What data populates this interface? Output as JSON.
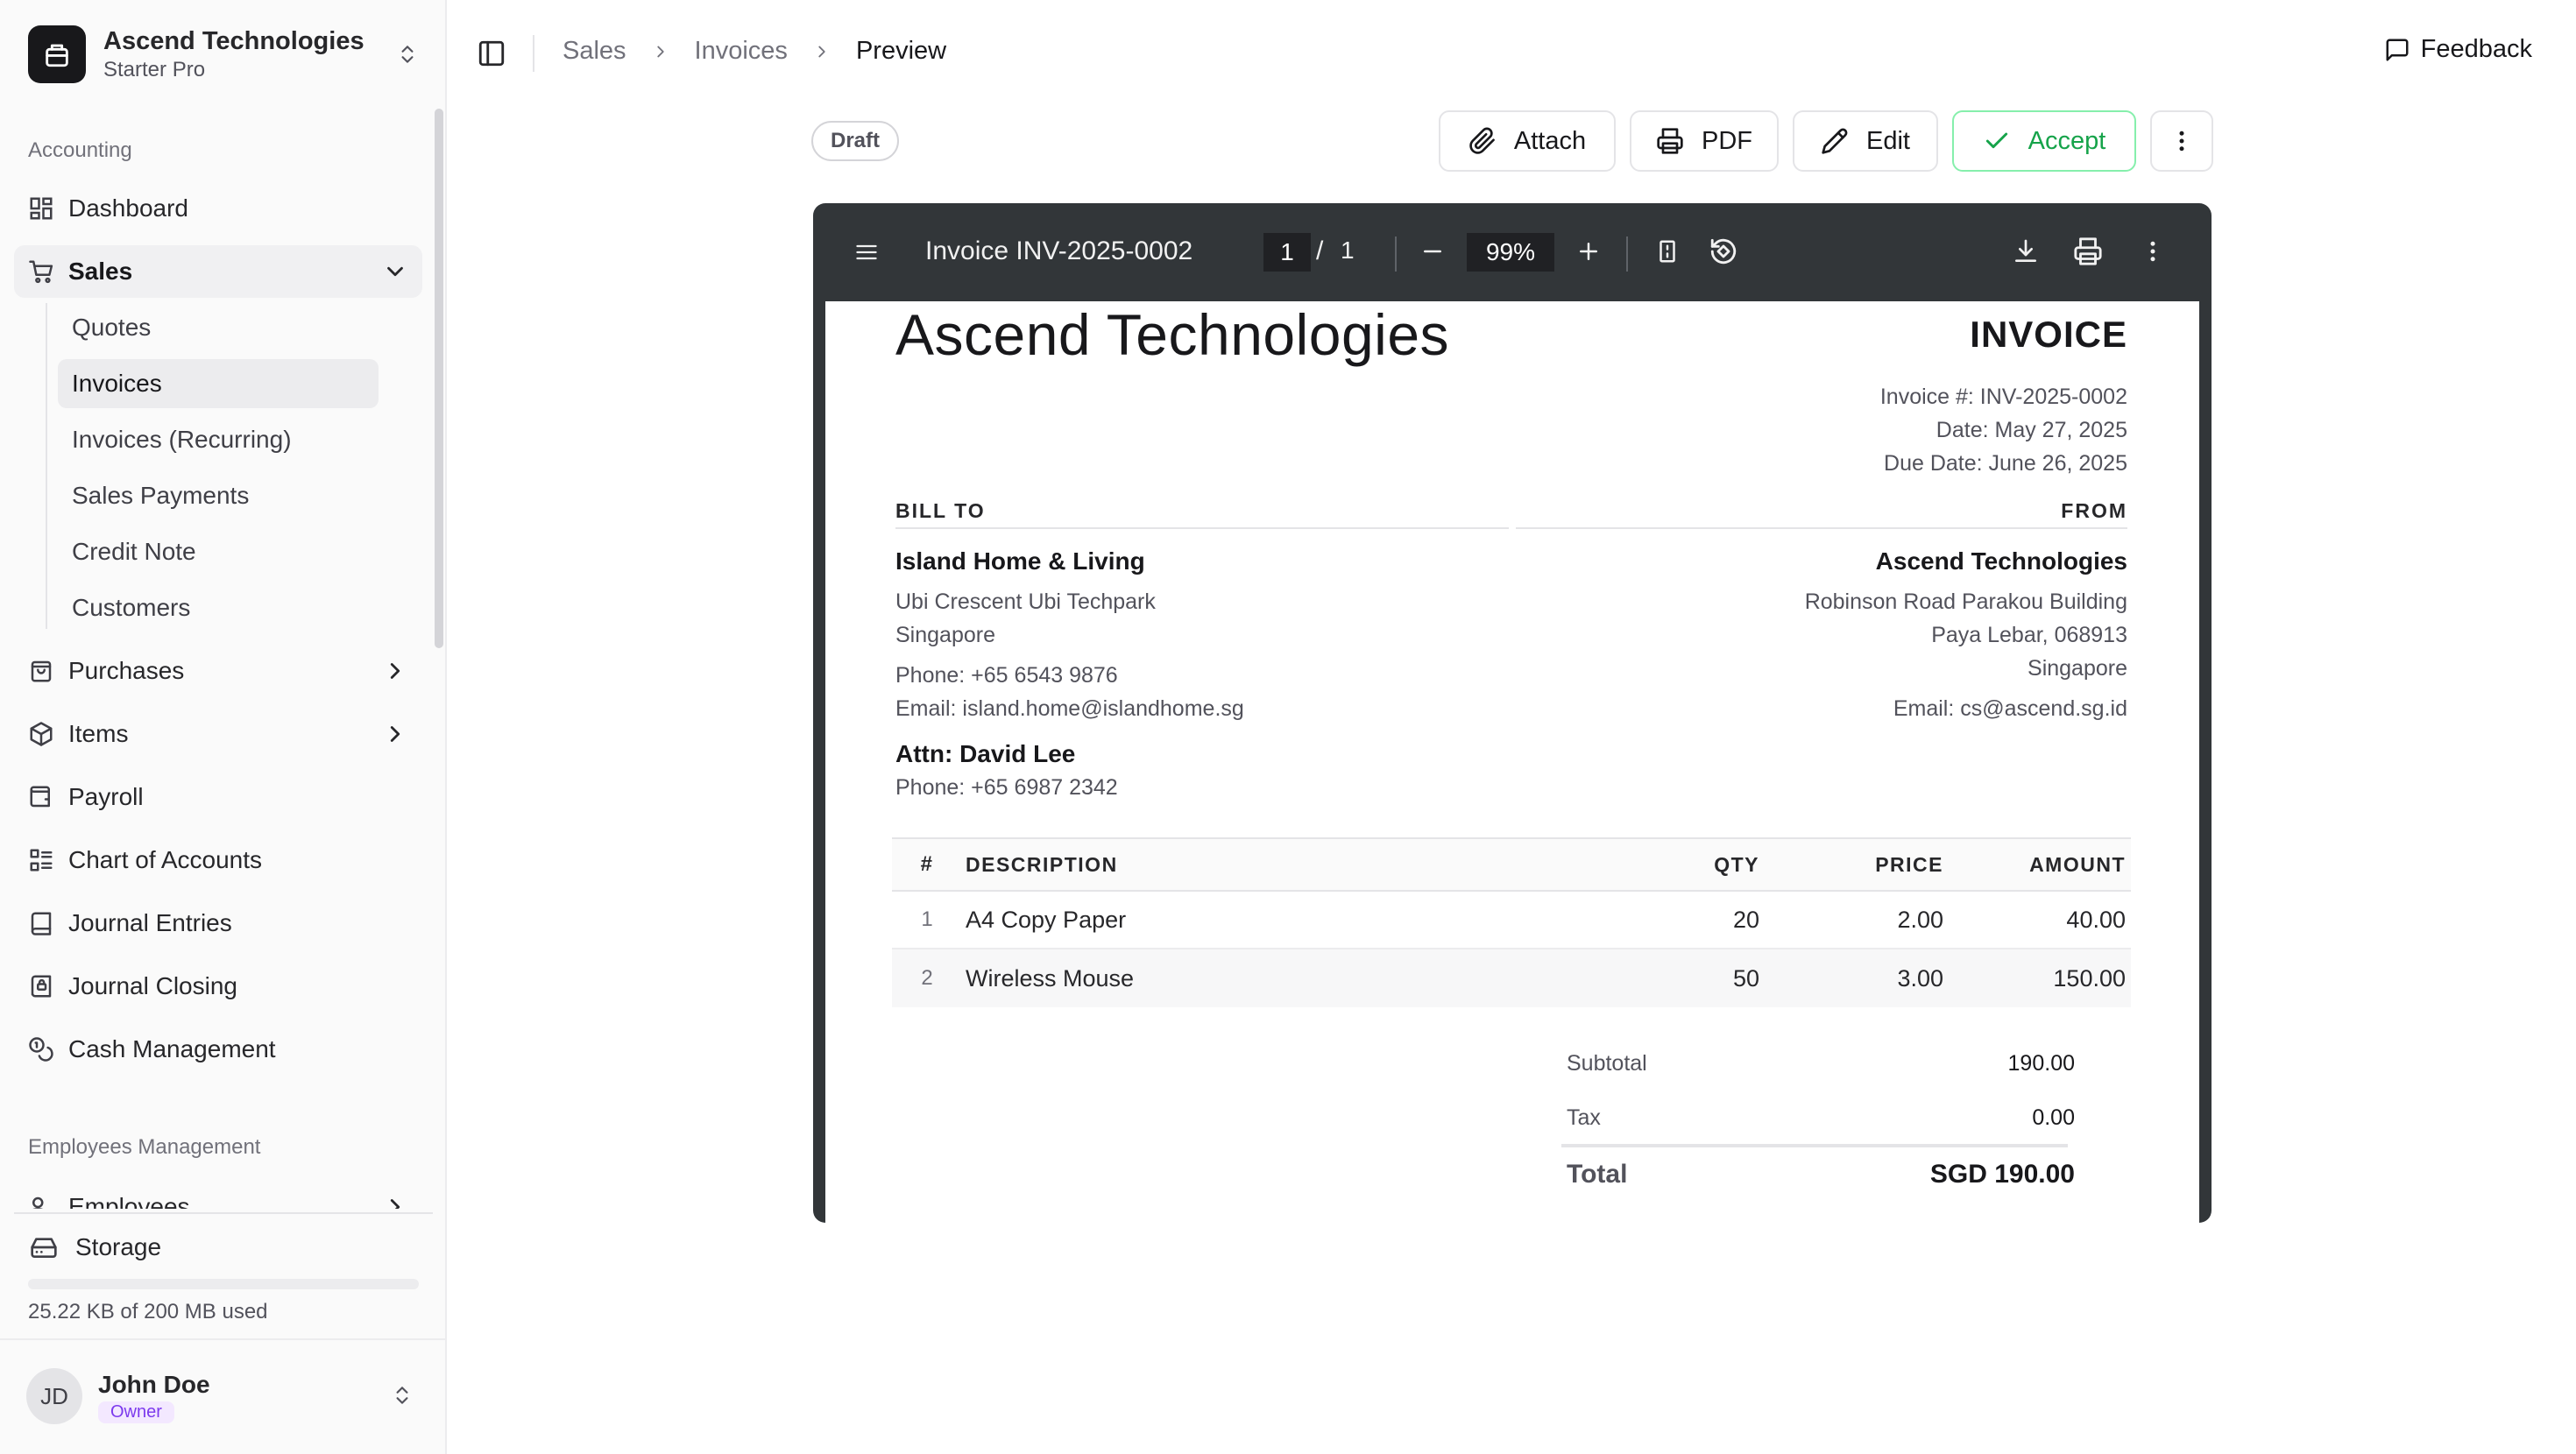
{
  "org": {
    "name": "Ascend Technologies",
    "plan": "Starter Pro"
  },
  "sidebar": {
    "section_accounting": "Accounting",
    "dashboard": "Dashboard",
    "sales": "Sales",
    "sales_items": [
      "Quotes",
      "Invoices",
      "Invoices (Recurring)",
      "Sales Payments",
      "Credit Note",
      "Customers"
    ],
    "purchases": "Purchases",
    "items": "Items",
    "payroll": "Payroll",
    "chart_of_accounts": "Chart of Accounts",
    "journal_entries": "Journal Entries",
    "journal_closing": "Journal Closing",
    "cash_management": "Cash Management",
    "section_employees": "Employees Management",
    "employees": "Employees",
    "storage": "Storage",
    "storage_used": "25.22 KB of 200 MB used",
    "storage_fraction": 0.0001
  },
  "user": {
    "initials": "JD",
    "name": "John Doe",
    "role": "Owner"
  },
  "breadcrumb": [
    "Sales",
    "Invoices",
    "Preview"
  ],
  "feedback": "Feedback",
  "status_badge": "Draft",
  "actions": {
    "attach": "Attach",
    "pdf": "PDF",
    "edit": "Edit",
    "accept": "Accept"
  },
  "viewer": {
    "title": "Invoice INV-2025-0002",
    "page": "1",
    "page_sep": "/",
    "pages": "1",
    "zoom": "99%"
  },
  "invoice": {
    "company": "Ascend Technologies",
    "heading": "INVOICE",
    "number_line": "Invoice #: INV-2025-0002",
    "date_line": "Date: May 27, 2025",
    "due_line": "Due Date: June 26, 2025",
    "bill_to_label": "BILL TO",
    "from_label": "FROM",
    "bill_to": {
      "name": "Island Home & Living",
      "address1": "Ubi Crescent Ubi Techpark",
      "address2": "Singapore",
      "phone": "Phone: +65 6543 9876",
      "email": "Email: island.home@islandhome.sg",
      "attn": "Attn: David Lee",
      "attn_phone": "Phone: +65 6987 2342"
    },
    "from": {
      "name": "Ascend Technologies",
      "address1": "Robinson Road Parakou Building",
      "address2": "Paya Lebar, 068913",
      "address3": "Singapore",
      "email": "Email: cs@ascend.sg.id"
    },
    "columns": {
      "num": "#",
      "desc": "DESCRIPTION",
      "qty": "QTY",
      "price": "PRICE",
      "amount": "AMOUNT"
    },
    "lines": [
      {
        "num": "1",
        "desc": "A4 Copy Paper",
        "qty": "20",
        "price": "2.00",
        "amount": "40.00"
      },
      {
        "num": "2",
        "desc": "Wireless Mouse",
        "qty": "50",
        "price": "3.00",
        "amount": "150.00"
      }
    ],
    "subtotal_label": "Subtotal",
    "subtotal": "190.00",
    "tax_label": "Tax",
    "tax": "0.00",
    "total_label": "Total",
    "total": "SGD 190.00"
  }
}
